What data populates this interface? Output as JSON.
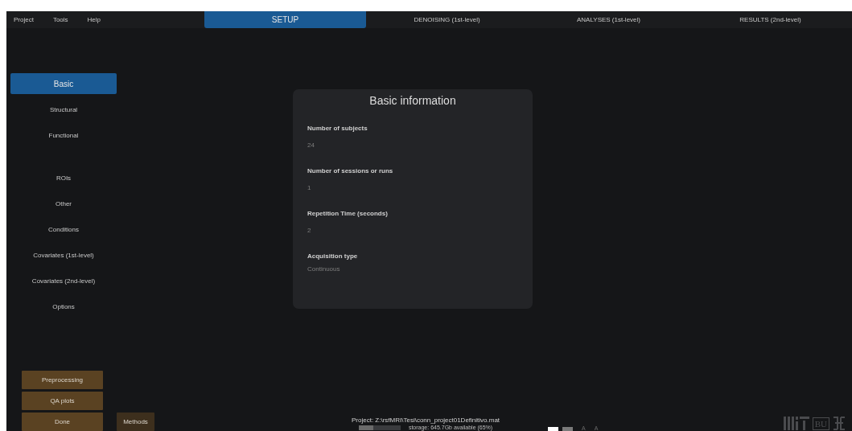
{
  "menu": [
    "Project",
    "Tools",
    "Help"
  ],
  "tabs": [
    {
      "label": "SETUP",
      "selected": true
    },
    {
      "label": "DENOISING (1st-level)",
      "selected": false
    },
    {
      "label": "ANALYSES (1st-level)",
      "selected": false
    },
    {
      "label": "RESULTS (2nd-level)",
      "selected": false
    }
  ],
  "sidebar": {
    "groups": [
      [
        {
          "label": "Basic",
          "selected": true
        },
        {
          "label": "Structural",
          "selected": false
        },
        {
          "label": "Functional",
          "selected": false
        }
      ],
      [
        {
          "label": "ROIs",
          "selected": false
        },
        {
          "label": "Other",
          "selected": false
        },
        {
          "label": "Conditions",
          "selected": false
        },
        {
          "label": "Covariates (1st-level)",
          "selected": false
        },
        {
          "label": "Covariates (2nd-level)",
          "selected": false
        },
        {
          "label": "Options",
          "selected": false
        }
      ]
    ]
  },
  "card": {
    "title": "Basic information",
    "fields": [
      {
        "label": "Number of subjects",
        "value": "24",
        "kind": "number"
      },
      {
        "label": "Number of sessions or runs",
        "value": "1",
        "kind": "number"
      },
      {
        "label": "Repetition Time (seconds)",
        "value": "2",
        "kind": "number"
      },
      {
        "label": "Acquisition type",
        "value": "Continuous",
        "kind": "select"
      }
    ]
  },
  "actions": [
    "Preprocessing",
    "QA plots",
    "Done"
  ],
  "methods_button": "Methods",
  "status": {
    "project": "Project: Z:\\rsfMRI\\Tesi\\conn_project01Definitivo.mat",
    "storage": "storage: 645.7Gb available (65%)",
    "storage_bar": {
      "level": 0.35
    }
  },
  "font_buttons": [
    "A",
    "A"
  ],
  "logo_text": "BU"
}
